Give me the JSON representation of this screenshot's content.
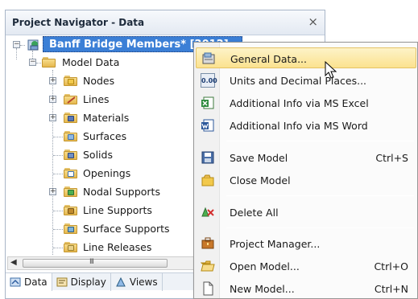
{
  "panel": {
    "title": "Project Navigator - Data",
    "close_glyph": "×"
  },
  "tree": {
    "project": "Banff Bridge Members* [2012]",
    "model_data": "Model Data",
    "items": [
      {
        "label": "Nodes",
        "icon": "nodes-folder-icon"
      },
      {
        "label": "Lines",
        "icon": "lines-folder-icon"
      },
      {
        "label": "Materials",
        "icon": "materials-folder-icon"
      },
      {
        "label": "Surfaces",
        "icon": "surfaces-folder-icon"
      },
      {
        "label": "Solids",
        "icon": "solids-folder-icon"
      },
      {
        "label": "Openings",
        "icon": "openings-folder-icon"
      },
      {
        "label": "Nodal Supports",
        "icon": "nodal-supports-folder-icon"
      },
      {
        "label": "Line Supports",
        "icon": "line-supports-folder-icon"
      },
      {
        "label": "Surface Supports",
        "icon": "surface-supports-folder-icon"
      },
      {
        "label": "Line Releases",
        "icon": "line-releases-folder-icon"
      }
    ]
  },
  "scrollbar": {
    "grip": "III"
  },
  "tabs": [
    {
      "label": "Data",
      "icon": "data-tab-icon"
    },
    {
      "label": "Display",
      "icon": "display-tab-icon"
    },
    {
      "label": "Views",
      "icon": "views-tab-icon"
    }
  ],
  "menu": {
    "items": [
      {
        "label": "General Data...",
        "shortcut": "",
        "icon": "general-data-icon"
      },
      {
        "label": "Units and Decimal Places...",
        "shortcut": "",
        "icon": "units-icon"
      },
      {
        "label": "Additional Info via MS Excel",
        "shortcut": "",
        "icon": "excel-icon"
      },
      {
        "label": "Additional Info via MS Word",
        "shortcut": "",
        "icon": "word-icon"
      },
      {
        "label": "Save Model",
        "shortcut": "Ctrl+S",
        "icon": "save-icon"
      },
      {
        "label": "Close Model",
        "shortcut": "",
        "icon": "close-model-icon"
      },
      {
        "label": "Delete All",
        "shortcut": "",
        "icon": "delete-all-icon"
      },
      {
        "label": "Project Manager...",
        "shortcut": "",
        "icon": "project-manager-icon"
      },
      {
        "label": "Open Model...",
        "shortcut": "Ctrl+O",
        "icon": "open-folder-icon"
      },
      {
        "label": "New Model...",
        "shortcut": "Ctrl+N",
        "icon": "new-document-icon"
      }
    ],
    "units_icon_text": "0.00"
  },
  "colors": {
    "selection": "#3b7fd6",
    "menu_hover": "#fbe28f",
    "folder": "#e6b84f"
  }
}
